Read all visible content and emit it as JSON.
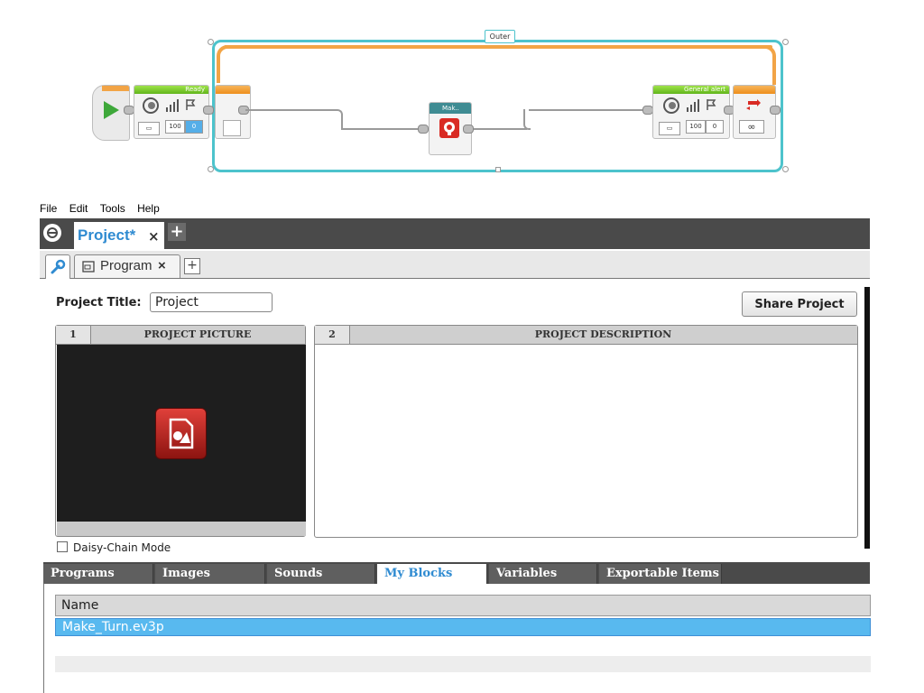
{
  "canvas": {
    "loop_label": "Outer",
    "sound_block_1": {
      "header": "Ready",
      "volume": "100",
      "play_type": "0"
    },
    "myblock": {
      "label": "Mak.."
    },
    "sound_block_2": {
      "header": "General alert",
      "volume": "100",
      "play_type": "0"
    },
    "loop_end_mode": "∞"
  },
  "menu": [
    "File",
    "Edit",
    "Tools",
    "Help"
  ],
  "project_tab": {
    "label": "Project*",
    "close": "×",
    "add": "+"
  },
  "program_tab": {
    "label": "Program",
    "close": "×",
    "add": "+"
  },
  "properties": {
    "title_label": "Project Title:",
    "title_value": "Project",
    "share_button": "Share Project",
    "picture_panel": {
      "number": "1",
      "title": "PROJECT PICTURE"
    },
    "description_panel": {
      "number": "2",
      "title": "PROJECT DESCRIPTION",
      "text": ""
    },
    "daisy_chain_label": "Daisy-Chain Mode",
    "daisy_chain_checked": false
  },
  "bottom_tabs": [
    {
      "label": "Programs",
      "active": false
    },
    {
      "label": "Images",
      "active": false
    },
    {
      "label": "Sounds",
      "active": false
    },
    {
      "label": "My Blocks",
      "active": true
    },
    {
      "label": "Variables",
      "active": false
    },
    {
      "label": "Exportable Items",
      "active": false
    }
  ],
  "list": {
    "header": "Name",
    "rows": [
      "Make_Turn.ev3p"
    ]
  },
  "colors": {
    "accent_blue": "#2f8bd1",
    "selection_blue": "#58b9ef",
    "loop_teal": "#4dc3cc",
    "loop_orange": "#f2a446",
    "block_green": "#7ccf2c",
    "start_green": "#3ea83a",
    "myblock_red": "#d92b24"
  }
}
